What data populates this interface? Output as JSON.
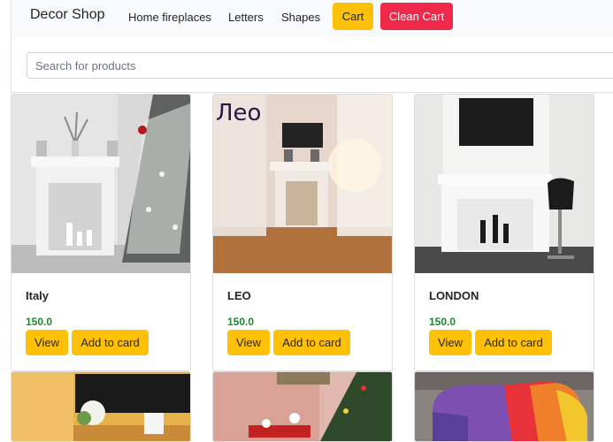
{
  "navbar": {
    "brand": "Decor Shop",
    "links": [
      "Home fireplaces",
      "Letters",
      "Shapes"
    ],
    "cart_label": "Cart",
    "clean_cart_label": "Clean Cart"
  },
  "search": {
    "placeholder": "Search for products"
  },
  "products": [
    {
      "name": "Italy",
      "price": "150.0",
      "view_label": "View",
      "add_label": "Add to card"
    },
    {
      "name": "LEO",
      "price": "150.0",
      "view_label": "View",
      "add_label": "Add to card",
      "image_caption": "Лео"
    },
    {
      "name": "LONDON",
      "price": "150.0",
      "view_label": "View",
      "add_label": "Add to card"
    }
  ],
  "colors": {
    "accent": "#ffc107",
    "danger": "#f0284a",
    "price": "#1a8a2e"
  }
}
